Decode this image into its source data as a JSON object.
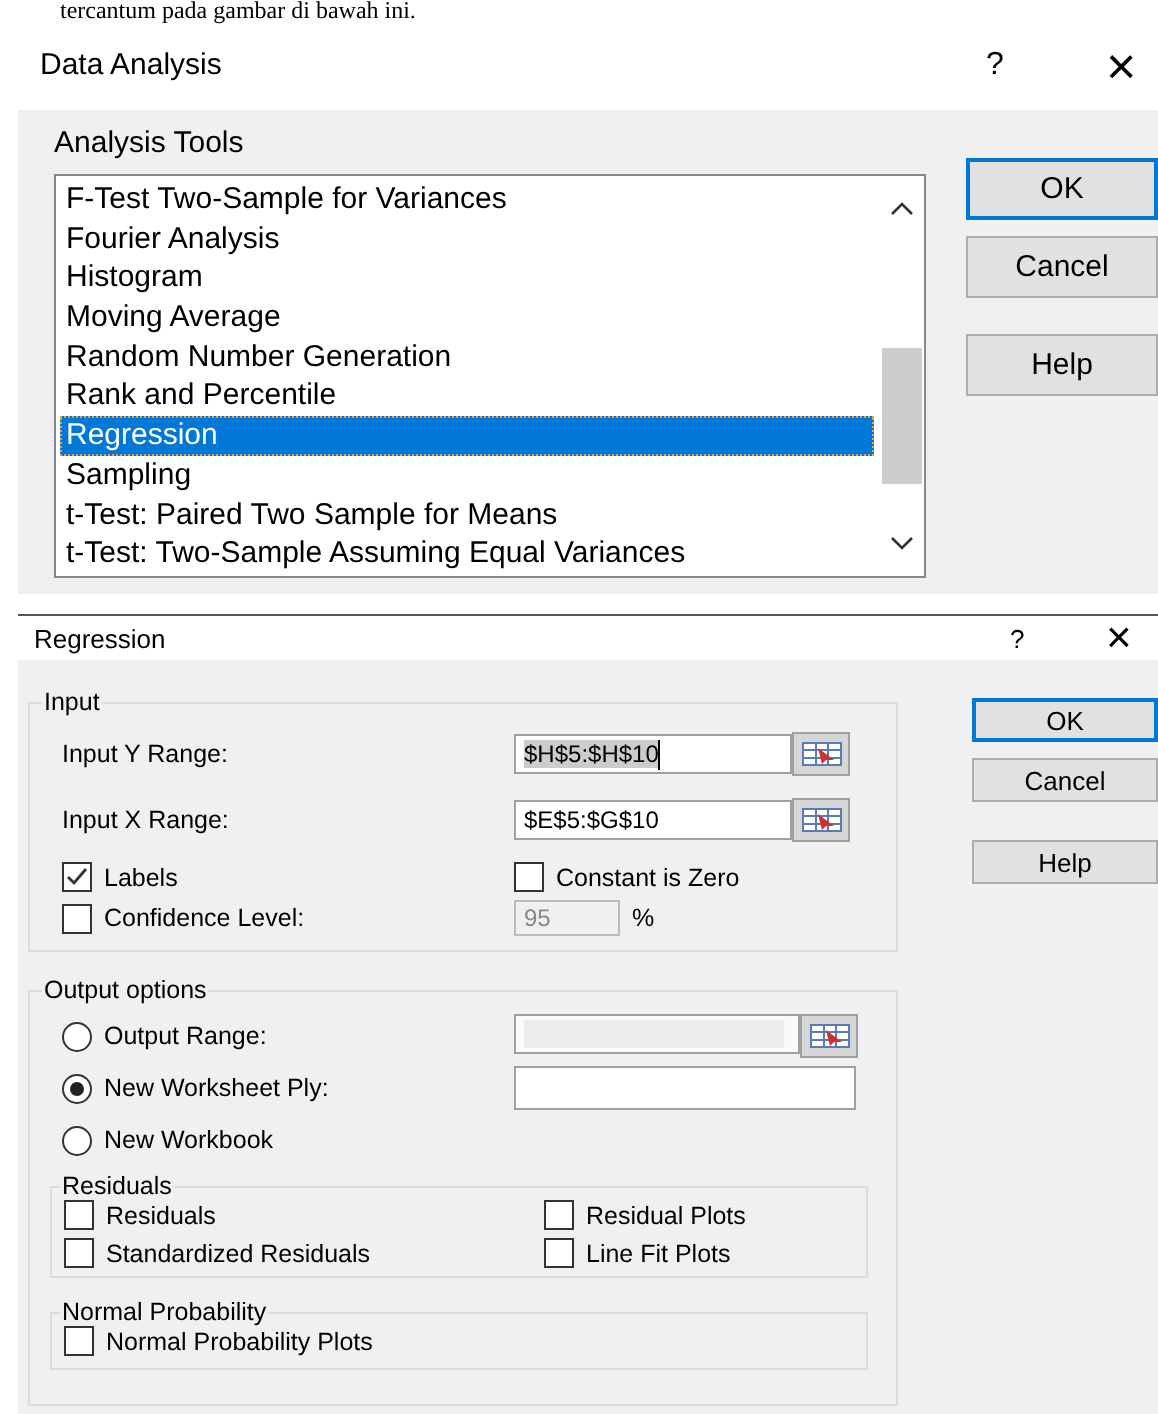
{
  "caption": "tercantum pada gambar di bawah ini.",
  "data_analysis": {
    "title": "Data Analysis",
    "help": "?",
    "close": "×",
    "list_label": "Analysis Tools",
    "items": [
      {
        "label": "F-Test Two-Sample for Variances",
        "selected": false
      },
      {
        "label": "Fourier Analysis",
        "selected": false
      },
      {
        "label": "Histogram",
        "selected": false
      },
      {
        "label": "Moving Average",
        "selected": false
      },
      {
        "label": "Random Number Generation",
        "selected": false
      },
      {
        "label": "Rank and Percentile",
        "selected": false
      },
      {
        "label": "Regression",
        "selected": true
      },
      {
        "label": "Sampling",
        "selected": false
      },
      {
        "label": "t-Test: Paired Two Sample for Means",
        "selected": false
      },
      {
        "label": "t-Test: Two-Sample Assuming Equal Variances",
        "selected": false
      }
    ],
    "buttons": [
      {
        "label": "OK",
        "default": true
      },
      {
        "label": "Cancel",
        "default": false
      },
      {
        "label": "Help",
        "default": false
      }
    ]
  },
  "regression": {
    "title": "Regression",
    "help": "?",
    "close": "×",
    "input": {
      "legend": "Input",
      "ranges": [
        {
          "label": "Input Y Range:",
          "value": "$H$5:$H$10",
          "focused": true
        },
        {
          "label": "Input X Range:",
          "value": "$E$5:$G$10",
          "focused": false
        }
      ],
      "labels": {
        "label": "Labels",
        "checked": true
      },
      "constant_zero": {
        "label": "Constant is Zero",
        "checked": false
      },
      "confidence": {
        "label": "Confidence Level:",
        "checked": false,
        "value": "95",
        "unit": "%"
      }
    },
    "output": {
      "legend": "Output options",
      "options": [
        {
          "label": "Output Range:",
          "selected": false,
          "kind": "range"
        },
        {
          "label": "New Worksheet Ply:",
          "selected": true,
          "kind": "text"
        },
        {
          "label": "New Workbook",
          "selected": false
        }
      ],
      "residuals": {
        "legend": "Residuals",
        "options": [
          {
            "label": "Residuals",
            "checked": false
          },
          {
            "label": "Residual Plots",
            "checked": false
          },
          {
            "label": "Standardized Residuals",
            "checked": false
          },
          {
            "label": "Line Fit Plots",
            "checked": false
          }
        ]
      },
      "normal": {
        "legend": "Normal Probability",
        "options": [
          {
            "label": "Normal Probability Plots",
            "checked": false
          }
        ]
      }
    },
    "buttons": [
      {
        "label": "OK",
        "default": true
      },
      {
        "label": "Cancel",
        "default": false
      },
      {
        "label": "Help",
        "default": false
      }
    ]
  }
}
